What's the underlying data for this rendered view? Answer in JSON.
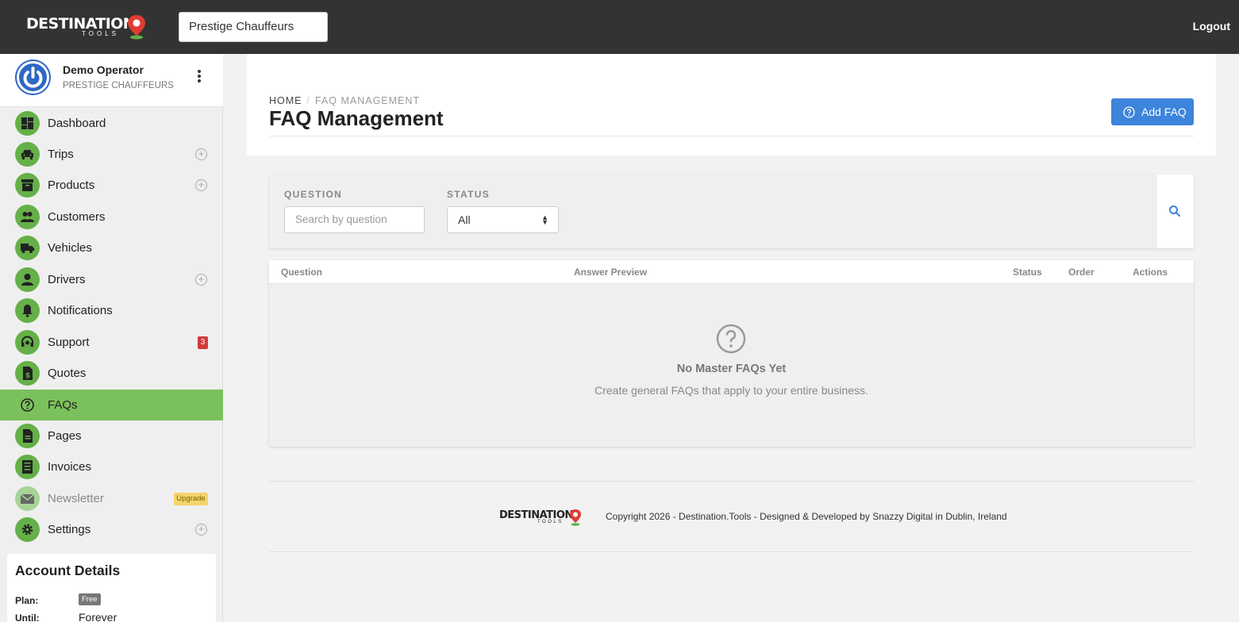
{
  "brand": {
    "logo_word": "DESTINATION",
    "logo_sub": "TOOLS"
  },
  "topbar": {
    "company": "Prestige Chauffeurs",
    "logout": "Logout"
  },
  "profile": {
    "name": "Demo Operator",
    "company": "PRESTIGE CHAUFFEURS"
  },
  "nav": [
    {
      "label": "Dashboard",
      "icon": "dashboard-icon"
    },
    {
      "label": "Trips",
      "icon": "car-icon",
      "plus": "+"
    },
    {
      "label": "Products",
      "icon": "archive-icon",
      "plus": "+"
    },
    {
      "label": "Customers",
      "icon": "people-icon"
    },
    {
      "label": "Vehicles",
      "icon": "truck-icon"
    },
    {
      "label": "Drivers",
      "icon": "person-icon",
      "plus": "+"
    },
    {
      "label": "Notifications",
      "icon": "bell-icon"
    },
    {
      "label": "Support",
      "icon": "headset-icon",
      "badge": "3"
    },
    {
      "label": "Quotes",
      "icon": "quote-doc-icon"
    },
    {
      "label": "FAQs",
      "icon": "help-circle-icon",
      "active": true
    },
    {
      "label": "Pages",
      "icon": "page-icon"
    },
    {
      "label": "Invoices",
      "icon": "invoice-icon"
    },
    {
      "label": "Newsletter",
      "icon": "mail-icon",
      "badge": "Upgrade",
      "disabled": true
    },
    {
      "label": "Settings",
      "icon": "gear-icon",
      "plus": "+"
    }
  ],
  "account": {
    "title": "Account Details",
    "plan_label": "Plan:",
    "plan_value": "Free",
    "until_label": "Until:",
    "until_value": "Forever"
  },
  "header": {
    "breadcrumb_home": "HOME",
    "breadcrumb_sep": "/",
    "breadcrumb_current": "FAQ MANAGEMENT",
    "title": "FAQ Management",
    "add_button": "Add FAQ"
  },
  "filters": {
    "question_label": "QUESTION",
    "question_placeholder": "Search by question",
    "status_label": "STATUS",
    "status_value": "All"
  },
  "table": {
    "columns": [
      "Question",
      "Answer Preview",
      "Status",
      "Order",
      "Actions"
    ],
    "empty_title": "No Master FAQs Yet",
    "empty_text": "Create general FAQs that apply to your entire business."
  },
  "footer": {
    "copyright": "Copyright 2026 - Destination.Tools - Designed & Developed by Snazzy Digital in Dublin, Ireland"
  },
  "colors": {
    "topbar": "#333333",
    "accent_green": "#65b048",
    "active_green": "#7bc15b",
    "primary_blue": "#3d84db",
    "logo_red": "#e03c31"
  }
}
